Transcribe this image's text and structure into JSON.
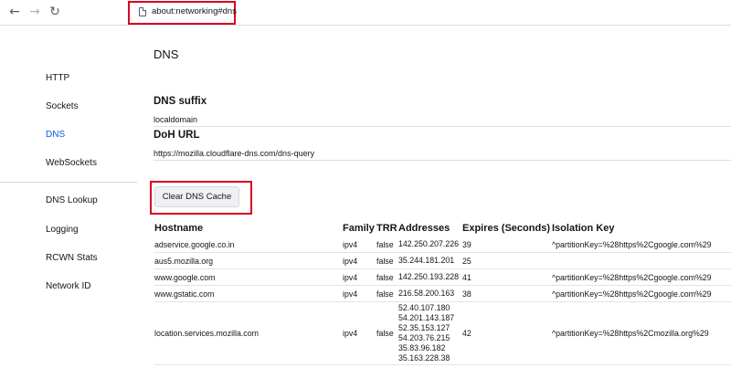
{
  "toolbar": {
    "back_icon": "←",
    "forward_icon": "→",
    "reload_icon": "↻",
    "url": "about:networking#dns"
  },
  "sidebar": {
    "items": [
      {
        "label": "HTTP"
      },
      {
        "label": "Sockets"
      },
      {
        "label": "DNS",
        "selected": true
      },
      {
        "label": "WebSockets"
      },
      {
        "label": "DNS Lookup"
      },
      {
        "label": "Logging"
      },
      {
        "label": "RCWN Stats"
      },
      {
        "label": "Network ID"
      }
    ]
  },
  "main": {
    "title": "DNS",
    "dns_suffix": {
      "label": "DNS suffix",
      "value": "localdomain"
    },
    "doh_url": {
      "label": "DoH URL",
      "value": "https://mozilla.cloudflare-dns.com/dns-query"
    },
    "clear_button": "Clear DNS Cache",
    "table": {
      "headers": {
        "hostname": "Hostname",
        "family": "Family",
        "trr": "TRR",
        "addresses": "Addresses",
        "expires": "Expires (Seconds)",
        "isolation": "Isolation Key"
      },
      "rows": [
        {
          "hostname": "adservice.google.co.in",
          "family": "ipv4",
          "trr": "false",
          "addresses": [
            "142.250.207.226"
          ],
          "expires": "39",
          "isolation": "^partitionKey=%28https%2Cgoogle.com%29"
        },
        {
          "hostname": "aus5.mozilla.org",
          "family": "ipv4",
          "trr": "false",
          "addresses": [
            "35.244.181.201"
          ],
          "expires": "25",
          "isolation": ""
        },
        {
          "hostname": "www.google.com",
          "family": "ipv4",
          "trr": "false",
          "addresses": [
            "142.250.193.228"
          ],
          "expires": "41",
          "isolation": "^partitionKey=%28https%2Cgoogle.com%29"
        },
        {
          "hostname": "www.gstatic.com",
          "family": "ipv4",
          "trr": "false",
          "addresses": [
            "216.58.200.163"
          ],
          "expires": "38",
          "isolation": "^partitionKey=%28https%2Cgoogle.com%29"
        },
        {
          "hostname": "location.services.mozilla.com",
          "family": "ipv4",
          "trr": "false",
          "addresses": [
            "52.40.107.180",
            "54.201.143.187",
            "52.35.153.127",
            "54.203.76.215",
            "35.83.96.182",
            "35.163.228.38"
          ],
          "expires": "42",
          "isolation": "^partitionKey=%28https%2Cmozilla.org%29"
        }
      ]
    }
  },
  "colors": {
    "accent": "#0061e0",
    "highlight_frame": "#d70022",
    "text": "#15141a"
  }
}
